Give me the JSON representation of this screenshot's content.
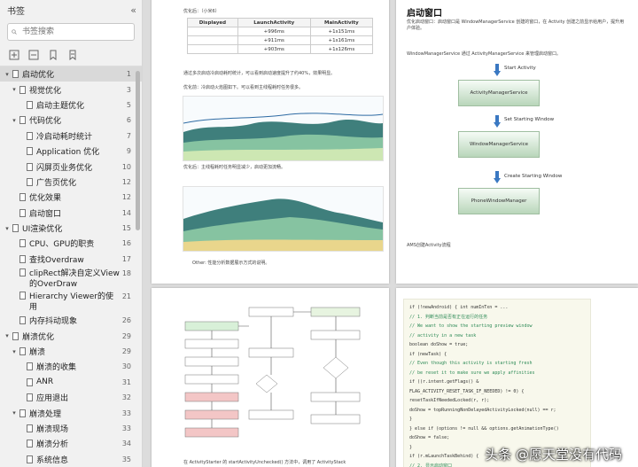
{
  "sidebar": {
    "title": "书签",
    "collapse_glyph": "«",
    "search_placeholder": "书签搜索",
    "items": [
      {
        "label": "启动优化",
        "page": "1",
        "level": 0,
        "expanded": true,
        "selected": true
      },
      {
        "label": "视觉优化",
        "page": "3",
        "level": 1,
        "expanded": true
      },
      {
        "label": "启动主题优化",
        "page": "5",
        "level": 2
      },
      {
        "label": "代码优化",
        "page": "6",
        "level": 1,
        "expanded": true
      },
      {
        "label": "冷启动耗时统计",
        "page": "7",
        "level": 2
      },
      {
        "label": "Application 优化",
        "page": "9",
        "level": 2
      },
      {
        "label": "闪屏页业务优化",
        "page": "10",
        "level": 2
      },
      {
        "label": "广告页优化",
        "page": "12",
        "level": 2
      },
      {
        "label": "优化效果",
        "page": "12",
        "level": 1
      },
      {
        "label": "启动窗口",
        "page": "14",
        "level": 1
      },
      {
        "label": "UI渲染优化",
        "page": "15",
        "level": 0,
        "expanded": true
      },
      {
        "label": "CPU、GPU的职责",
        "page": "16",
        "level": 1
      },
      {
        "label": "查找Overdraw",
        "page": "17",
        "level": 1
      },
      {
        "label": "clipRect解决自定义View的OverDraw",
        "page": "18",
        "level": 1,
        "multi": true
      },
      {
        "label": "Hierarchy Viewer的使用",
        "page": "21",
        "level": 1,
        "multi": true
      },
      {
        "label": "内存抖动现象",
        "page": "26",
        "level": 1
      },
      {
        "label": "崩溃优化",
        "page": "29",
        "level": 0,
        "expanded": true
      },
      {
        "label": "崩溃",
        "page": "29",
        "level": 1,
        "expanded": true
      },
      {
        "label": "崩溃的收集",
        "page": "30",
        "level": 2
      },
      {
        "label": "ANR",
        "page": "31",
        "level": 2
      },
      {
        "label": "应用退出",
        "page": "32",
        "level": 2
      },
      {
        "label": "崩溃处理",
        "page": "33",
        "level": 1,
        "expanded": true
      },
      {
        "label": "崩溃现场",
        "page": "33",
        "level": 2
      },
      {
        "label": "崩溃分析",
        "page": "34",
        "level": 2
      },
      {
        "label": "系统信息",
        "page": "35",
        "level": 2
      }
    ]
  },
  "doc": {
    "tl_label": "优化后：（小米6）",
    "table_headers": [
      "Displayed",
      "LaunchActivity",
      "MainActivity"
    ],
    "table_rows": [
      [
        "",
        "+996ms",
        "+1s151ms"
      ],
      [
        "",
        "+911ms",
        "+1s161ms"
      ],
      [
        "",
        "+903ms",
        "+1s126ms"
      ]
    ],
    "tl_para1": "通过多次启动冷启动耗时统计，可以看到启动速度提升了约40%，效果明显。",
    "tl_para2": "优化前：冷启动火焰图如下。可以看到主线程耗时任务很多。",
    "tl_para3": "优化后：主线程耗时任务明显减少，启动更加流畅。",
    "tl_bullet": "Other: 性能分析数据展示方式的说明。",
    "tr_title": "启动窗口",
    "tr_para": "优化启动窗口：启动窗口是 WindowManagerService 创建的窗口，在 Activity 创建之前显示给用户，提升用户体验。",
    "tr_para2": "WindowManagerService 通过 ActivityManagerService 来管理启动窗口。",
    "flow": [
      {
        "label": "Start Activity"
      },
      {
        "box": "ActivityManagerService"
      },
      {
        "label": "Set Starting Window"
      },
      {
        "box": "WindowManagerService"
      },
      {
        "label": "Create Starting Window"
      },
      {
        "box": "PhoneWindowManager"
      }
    ],
    "tr_caption": "AMS创建Activity流程",
    "bl_caption": "在 ActivityStarter 的 startActivityUnchecked() 方法中，调用了 ActivityStack",
    "code_lines": [
      "if (!newAndroid) {  int numInTxn = ...",
      "// 1. 判断当前是否有正在运行的任务",
      "// We want to show the starting preview window",
      "// activity in a new task",
      "boolean doShow = true;",
      "if (newTask) {",
      "  // Even though this activity is starting fresh",
      "  // be reset it to make sure we apply affinities",
      "  if ((r.intent.getFlags() &",
      "      FLAG_ACTIVITY_RESET_TASK_IF_NEEDED) != 0) {",
      "    resetTaskIfNeededLocked(r, r);",
      "    doShow = topRunningNonDelayedActivityLocked(null) == r;",
      "  }",
      "} else if (options != null && options.getAnimationType()",
      "  doShow = false;",
      "}",
      "if (r.mLaunchTaskBehind) {",
      "  // 2. 显示启动窗口"
    ],
    "watermark": "头条 @愿天堂没有代码"
  },
  "colors": {
    "sidebar_bg": "#f1f1f1",
    "selected_bg": "#d9d9d9",
    "doc_bg": "#dcdcdc"
  }
}
